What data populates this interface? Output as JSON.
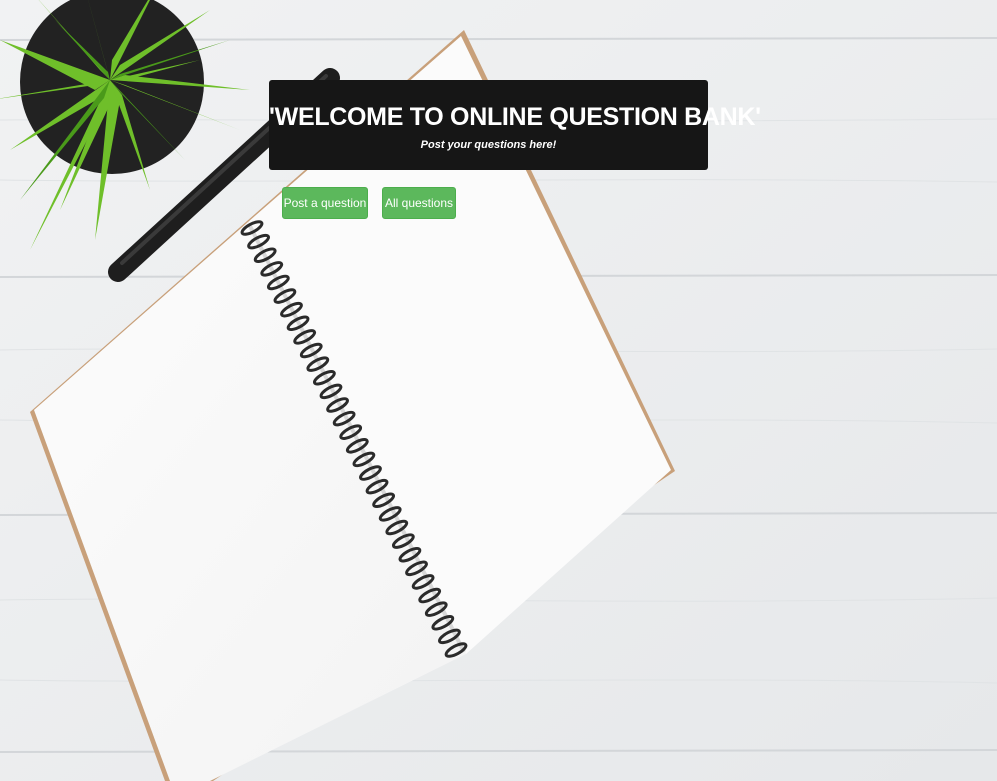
{
  "hero": {
    "title": "'WELCOME TO ONLINE QUESTION BANK'",
    "subtitle": "Post your questions here!"
  },
  "buttons": {
    "post_question": "Post a question",
    "all_questions": "All questions"
  },
  "colors": {
    "hero_background": "#161616",
    "button_green": "#5cb85c",
    "wood_background": "#eef0f1"
  }
}
